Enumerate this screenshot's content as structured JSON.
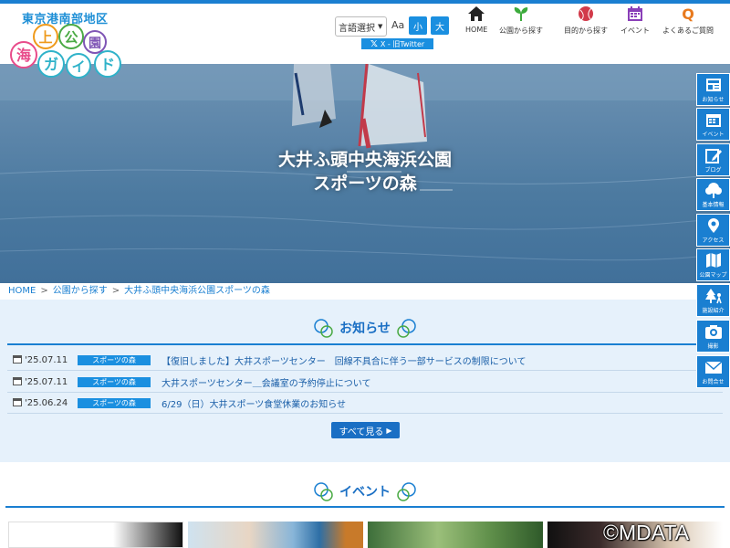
{
  "header": {
    "region": "東京港南部地区",
    "logo_text": [
      "海",
      "上",
      "公",
      "園",
      "ガ",
      "イ",
      "ド"
    ],
    "language_select": "言語選択",
    "font_size_label": "Aa",
    "font_small": "小",
    "font_large": "大",
    "x_link": "X - 旧Twitter",
    "nav": [
      {
        "label": "HOME",
        "icon": "home-icon"
      },
      {
        "label": "公園から探す",
        "icon": "sprout-icon"
      },
      {
        "label": "目的から探す",
        "icon": "ball-icon"
      },
      {
        "label": "イベント",
        "icon": "calendar-icon"
      },
      {
        "label": "よくあるご質問",
        "icon": "q-icon"
      }
    ]
  },
  "hero": {
    "title_line1": "大井ふ頭中央海浜公園",
    "title_line2": "スポーツの森"
  },
  "breadcrumb": [
    "HOME",
    "公園から探す",
    "大井ふ頭中央海浜公園スポーツの森"
  ],
  "news": {
    "title": "お知らせ",
    "items": [
      {
        "date": "'25.07.11",
        "tag": "スポーツの森",
        "title": "【復旧しました】大井スポーツセンター　回線不具合に伴う一部サービスの制限について"
      },
      {
        "date": "'25.07.11",
        "tag": "スポーツの森",
        "title": "大井スポーツセンター＿会議室の予約停止について"
      },
      {
        "date": "'25.06.24",
        "tag": "スポーツの森",
        "title": "6/29（日）大井スポーツ食堂休業のお知らせ"
      }
    ],
    "more_label": "すべて見る"
  },
  "events": {
    "title": "イベント"
  },
  "side_menu": [
    {
      "label": "お知らせ",
      "icon": "news-icon"
    },
    {
      "label": "イベント",
      "icon": "calendar-icon"
    },
    {
      "label": "ブログ",
      "icon": "pen-icon"
    },
    {
      "label": "基本情報",
      "icon": "tree-icon"
    },
    {
      "label": "アクセス",
      "icon": "pin-icon"
    },
    {
      "label": "公園マップ",
      "icon": "map-icon"
    },
    {
      "label": "施設紹介",
      "icon": "facility-icon"
    },
    {
      "label": "撮影",
      "icon": "camera-icon"
    },
    {
      "label": "お問合せ",
      "icon": "mail-icon"
    }
  ],
  "watermark": "©MDATA",
  "colors": {
    "accent": "#1a7fd1",
    "news_bg": "#e6f1fb",
    "tag": "#1a8fe0"
  }
}
